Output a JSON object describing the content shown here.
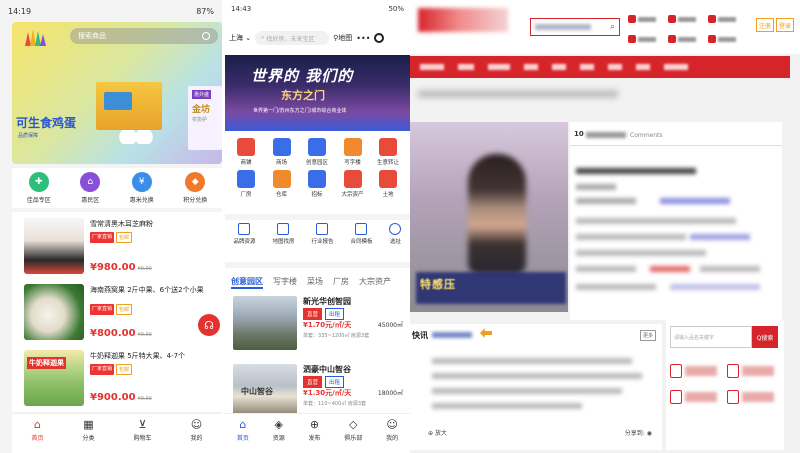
{
  "panel1": {
    "status": {
      "time": "14:19",
      "battery": "87%"
    },
    "search_placeholder": "搜索商品",
    "hero": {
      "title": "可生食鸡蛋",
      "subtitle": "品质保障",
      "side_badge": "惠外盛",
      "side_title": "金坊",
      "side_sub": "农协护"
    },
    "categories": [
      {
        "label": "佳品专区",
        "icon": "gift-icon",
        "color": "#2cbf7a",
        "glyph": "✚"
      },
      {
        "label": "惠民区",
        "icon": "home-icon",
        "color": "#8a4fd8",
        "glyph": "⌂"
      },
      {
        "label": "惠米兑换",
        "icon": "money-bag-icon",
        "color": "#3a8ee8",
        "glyph": "¥"
      },
      {
        "label": "积分兑换",
        "icon": "points-icon",
        "color": "#f07a2c",
        "glyph": "◆"
      }
    ],
    "products": [
      {
        "name": "雪常清黑木耳芝麻粉",
        "tag1": "厂家直销",
        "tag2": "包邮",
        "price": "¥980.00",
        "old_price": "¥0.00"
      },
      {
        "name": "海南燕窝果 2斤中果、6个送2个小果",
        "tag1": "厂家直销",
        "tag2": "包邮",
        "price": "¥800.00",
        "old_price": "¥0.00"
      },
      {
        "name": "牛奶释迦果 5斤特大果、4-7个",
        "tag1": "厂家直销",
        "tag2": "包邮",
        "price": "¥900.00",
        "old_price": "¥0.00",
        "image_text": "牛奶释迦果"
      }
    ],
    "nav": [
      {
        "label": "首页",
        "icon": "home-icon",
        "glyph": "⌂",
        "active": true
      },
      {
        "label": "分类",
        "icon": "grid-icon",
        "glyph": "▦",
        "active": false
      },
      {
        "label": "购物车",
        "icon": "cart-icon",
        "glyph": "⊻",
        "active": false
      },
      {
        "label": "我的",
        "icon": "user-icon",
        "glyph": "☺",
        "active": false
      }
    ]
  },
  "panel2": {
    "status": {
      "time": "14:43",
      "battery": "50%"
    },
    "city": "上海",
    "search_placeholder": "找好房，未来宝区",
    "map_label": "地图",
    "banner": {
      "line1": "世界的 我们的",
      "line2": "东方之门",
      "line3": "世界第一门/苏州东方之门/城市综合商业体"
    },
    "grid": [
      {
        "label": "商铺",
        "color": "#e84b3c"
      },
      {
        "label": "商场",
        "color": "#3a6ee8"
      },
      {
        "label": "创意园区",
        "color": "#3a6ee8"
      },
      {
        "label": "写字楼",
        "color": "#f08a2c"
      },
      {
        "label": "生意转让",
        "color": "#e84b3c"
      },
      {
        "label": "厂房",
        "color": "#3a6ee8"
      },
      {
        "label": "仓库",
        "color": "#f08a2c"
      },
      {
        "label": "招标",
        "color": "#3a6ee8"
      },
      {
        "label": "大宗资产",
        "color": "#e84b3c"
      },
      {
        "label": "土地",
        "color": "#e84b3c"
      }
    ],
    "tools": [
      "品牌资源",
      "地图找房",
      "行业报告",
      "合同模板",
      "选址"
    ],
    "tabs": [
      "创意园区",
      "写字楼",
      "菜场",
      "厂房",
      "大宗资产"
    ],
    "active_tab": 0,
    "listings": [
      {
        "name": "新光华创智园",
        "tag1": "直营",
        "tag2": "出租",
        "price": "¥1.70元/㎡/天",
        "area": "45000㎡",
        "detail": "单套：335~1200㎡ 房源3套"
      },
      {
        "name": "泗豪中山智谷",
        "tag1": "直营",
        "tag2": "出租",
        "price": "¥1.30元/㎡/天",
        "area": "18000㎡",
        "detail": "单套：110~400㎡ 房源3套",
        "image_text": "中山智谷"
      }
    ],
    "nav": [
      {
        "label": "首页",
        "icon": "home-icon",
        "glyph": "⌂",
        "active": true
      },
      {
        "label": "资源",
        "icon": "layers-icon",
        "glyph": "◈",
        "active": false
      },
      {
        "label": "发布",
        "icon": "plus-circle-icon",
        "glyph": "⊕",
        "active": false
      },
      {
        "label": "俱乐部",
        "icon": "club-icon",
        "glyph": "◇",
        "active": false
      },
      {
        "label": "我的",
        "icon": "user-icon",
        "glyph": "☺",
        "active": false
      }
    ]
  },
  "panel3": {
    "brand_color": "#d6242b",
    "video_caption": "特感压",
    "comments_num": "10",
    "comments_label": "Comments",
    "news_title": "快讯",
    "news_more": "更多",
    "share_label": "放大",
    "share_label2": "分享到:",
    "search_placeholder": "请输入品名关键字",
    "search_button": "Q搜索",
    "header_buttons": [
      "注册",
      "登录"
    ]
  }
}
